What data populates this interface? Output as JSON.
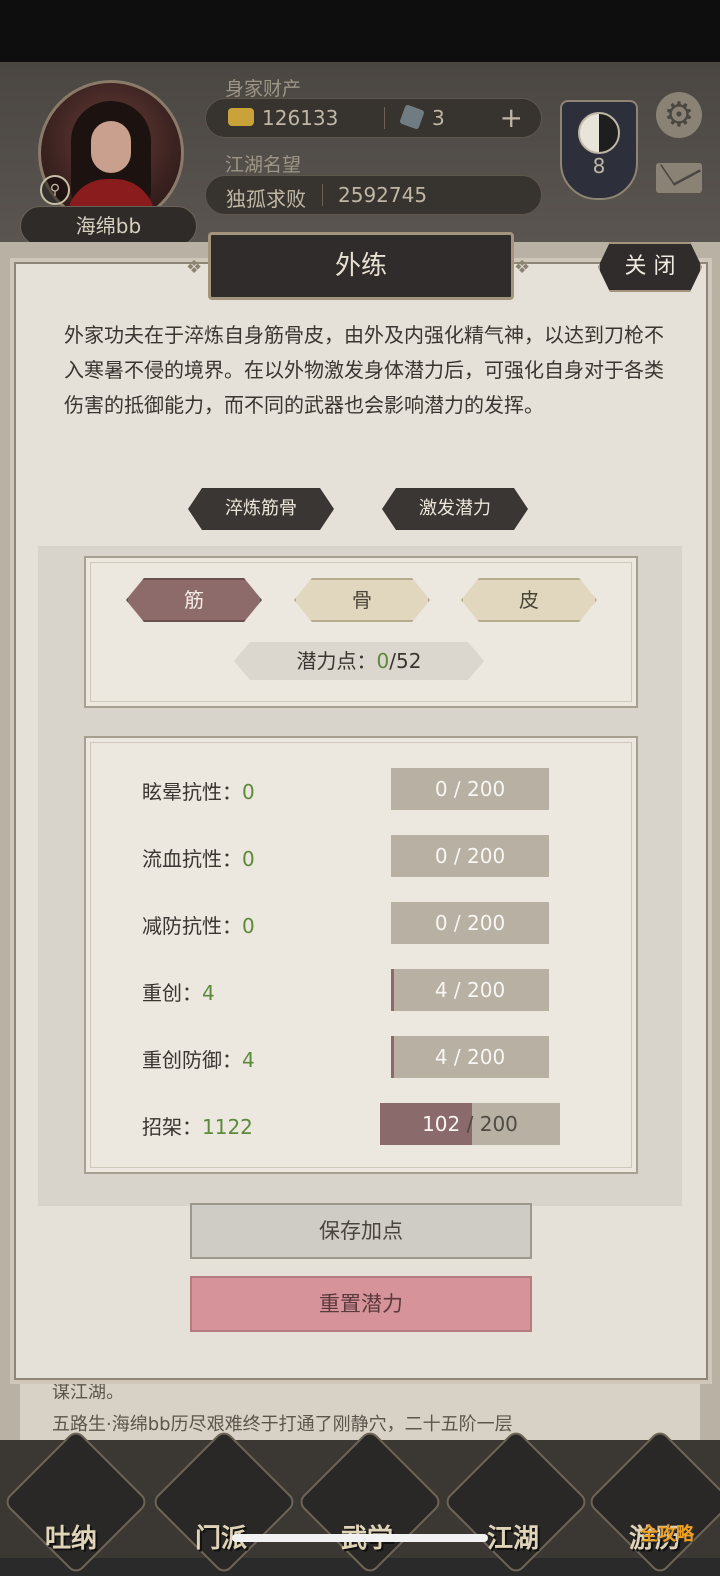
{
  "header": {
    "player_name": "海绵bb",
    "wealth_label": "身家财产",
    "gold": "126133",
    "gems": "3",
    "fame_label": "江湖名望",
    "rank_title": "独孤求败",
    "fame_value": "2592745",
    "taiji_level": "8"
  },
  "modal": {
    "title": "外练",
    "close_label": "关 闭",
    "description": "外家功夫在于淬炼自身筋骨皮，由外及内强化精气神，以达到刀枪不入寒暑不侵的境界。在以外物激发身体潜力后，可强化自身对于各类伤害的抵御能力，而不同的武器也会影响潜力的发挥。",
    "sub_tabs": [
      "淬炼筋骨",
      "激发潜力"
    ],
    "segments": [
      "筋",
      "骨",
      "皮"
    ],
    "active_segment": "筋",
    "points_label": "潜力点：",
    "points_current": "0",
    "points_max": "/52",
    "stats": [
      {
        "label": "眩晕抗性：",
        "value": "0",
        "current": "0",
        "max": " / 200",
        "fill": 0.0
      },
      {
        "label": "流血抗性：",
        "value": "0",
        "current": "0",
        "max": " / 200",
        "fill": 0.0
      },
      {
        "label": "减防抗性：",
        "value": "0",
        "current": "0",
        "max": " / 200",
        "fill": 0.0
      },
      {
        "label": "重创：",
        "value": "4",
        "current": "4",
        "max": " / 200",
        "fill": 0.02
      },
      {
        "label": "重创防御：",
        "value": "4",
        "current": "4",
        "max": " / 200",
        "fill": 0.02
      },
      {
        "label": "招架：",
        "value": "1122",
        "current": "102",
        "max": " / 200",
        "fill": 0.51
      }
    ],
    "save_label": "保存加点",
    "reset_label": "重置潜力"
  },
  "background": {
    "log_line_1": "谋江湖。",
    "log_line_2": "五路生·海绵bb历尽艰难终于打通了刚静穴，二十五阶一层"
  },
  "bottom_nav": [
    "吐纳",
    "门派",
    "武学",
    "江湖",
    "游历"
  ],
  "watermark": "全攻略",
  "colors": {
    "accent_active": "#8d6b6b",
    "green_value": "#5b8a3a",
    "reset_button": "#d7939a"
  }
}
